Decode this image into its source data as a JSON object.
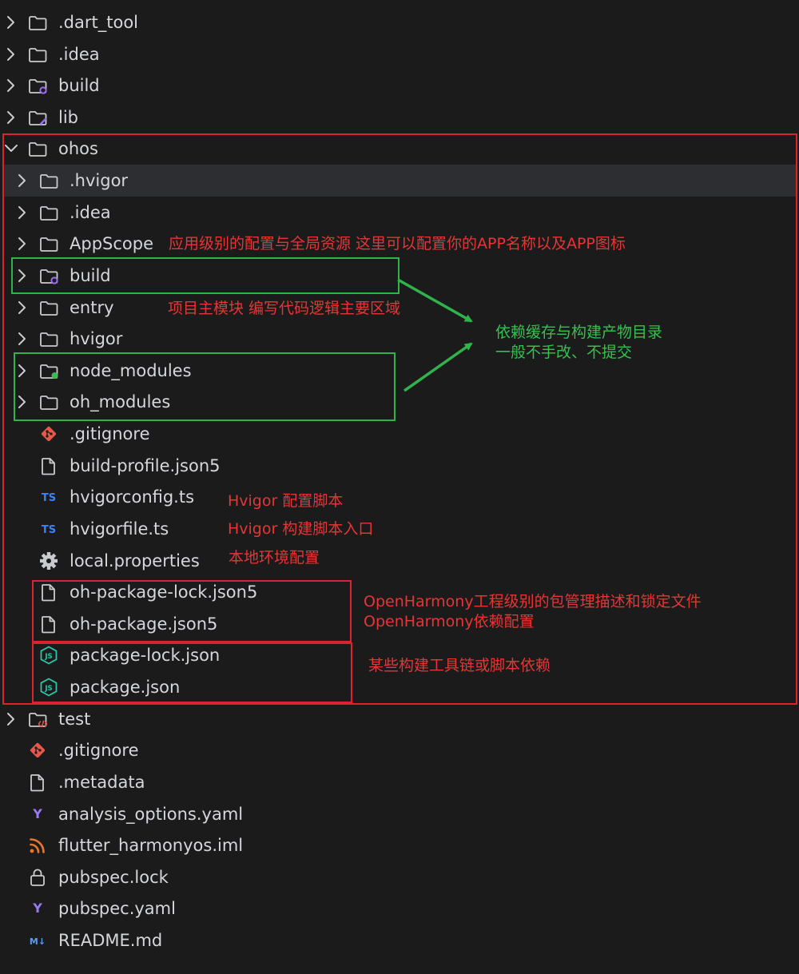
{
  "colors": {
    "background": "#1b1b1c",
    "text": "#d5d7db",
    "folder_icon": "#c9cbcf",
    "annotation_red": "#e63535",
    "box_red": "#d9232e",
    "annotation_green": "#36c04e",
    "box_green": "#2fb34a",
    "ts_blue": "#3b82f6",
    "json_teal": "#2bc6a8",
    "git_red": "#e5594a",
    "yaml_purple": "#9a7cf0",
    "rss_orange": "#e8772e",
    "md_blue": "#5b9bf5",
    "build_badge": "#9b6cf2",
    "node_badge": "#3cb94f"
  },
  "tree": [
    {
      "label": ".dart_tool",
      "icon": "folder-icon",
      "expandable": true,
      "expanded": false
    },
    {
      "label": ".idea",
      "icon": "folder-icon",
      "expandable": true,
      "expanded": false
    },
    {
      "label": "build",
      "icon": "build-folder-icon",
      "expandable": true,
      "expanded": false
    },
    {
      "label": "lib",
      "icon": "lib-folder-icon",
      "expandable": true,
      "expanded": false
    },
    {
      "label": "ohos",
      "icon": "folder-icon",
      "expandable": true,
      "expanded": true
    },
    {
      "label": ".hvigor",
      "icon": "folder-icon",
      "expandable": true,
      "expanded": false,
      "selected": true
    },
    {
      "label": ".idea",
      "icon": "folder-icon",
      "expandable": true,
      "expanded": false
    },
    {
      "label": "AppScope",
      "icon": "folder-icon",
      "expandable": true,
      "expanded": false
    },
    {
      "label": "build",
      "icon": "build-folder-icon",
      "expandable": true,
      "expanded": false
    },
    {
      "label": "entry",
      "icon": "folder-icon",
      "expandable": true,
      "expanded": false
    },
    {
      "label": "hvigor",
      "icon": "folder-icon",
      "expandable": true,
      "expanded": false
    },
    {
      "label": "node_modules",
      "icon": "node-modules-folder-icon",
      "expandable": true,
      "expanded": false
    },
    {
      "label": "oh_modules",
      "icon": "folder-icon",
      "expandable": true,
      "expanded": false
    },
    {
      "label": ".gitignore",
      "icon": "git-icon",
      "expandable": false
    },
    {
      "label": "build-profile.json5",
      "icon": "file-icon",
      "expandable": false
    },
    {
      "label": "hvigorconfig.ts",
      "icon": "typescript-icon",
      "expandable": false,
      "badge": "TS"
    },
    {
      "label": "hvigorfile.ts",
      "icon": "typescript-icon",
      "expandable": false,
      "badge": "TS"
    },
    {
      "label": "local.properties",
      "icon": "gear-icon",
      "expandable": false
    },
    {
      "label": "oh-package-lock.json5",
      "icon": "file-icon",
      "expandable": false
    },
    {
      "label": "oh-package.json5",
      "icon": "file-icon",
      "expandable": false
    },
    {
      "label": "package-lock.json",
      "icon": "json-icon",
      "expandable": false
    },
    {
      "label": "package.json",
      "icon": "json-icon",
      "expandable": false
    },
    {
      "label": "test",
      "icon": "test-folder-icon",
      "expandable": true,
      "expanded": false
    },
    {
      "label": ".gitignore",
      "icon": "git-icon",
      "expandable": false
    },
    {
      "label": ".metadata",
      "icon": "file-icon",
      "expandable": false
    },
    {
      "label": "analysis_options.yaml",
      "icon": "yaml-icon",
      "expandable": false,
      "badge": "Y"
    },
    {
      "label": "flutter_harmonyos.iml",
      "icon": "rss-icon",
      "expandable": false
    },
    {
      "label": "pubspec.lock",
      "icon": "lock-icon",
      "expandable": false
    },
    {
      "label": "pubspec.yaml",
      "icon": "yaml-icon",
      "expandable": false,
      "badge": "Y"
    },
    {
      "label": "README.md",
      "icon": "markdown-icon",
      "expandable": false,
      "badge": "M↓"
    }
  ],
  "annotations": {
    "appscope": "应用级别的配置与全局资源 这里可以配置你的APP名称以及APP图标",
    "entry": "项目主模块  编写代码逻辑主要区域",
    "cache_line1": "依赖缓存与构建产物目录",
    "cache_line2": "一般不手改、不提交",
    "hvigor_config": "Hvigor 配置脚本",
    "hvigor_file": "Hvigor 构建脚本入口",
    "local_properties": "本地环境配置",
    "oh_package_line1": "OpenHarmony工程级别的包管理描述和锁定文件",
    "oh_package_line2": "OpenHarmony依赖配置",
    "package_json": "某些构建工具链或脚本依赖"
  }
}
